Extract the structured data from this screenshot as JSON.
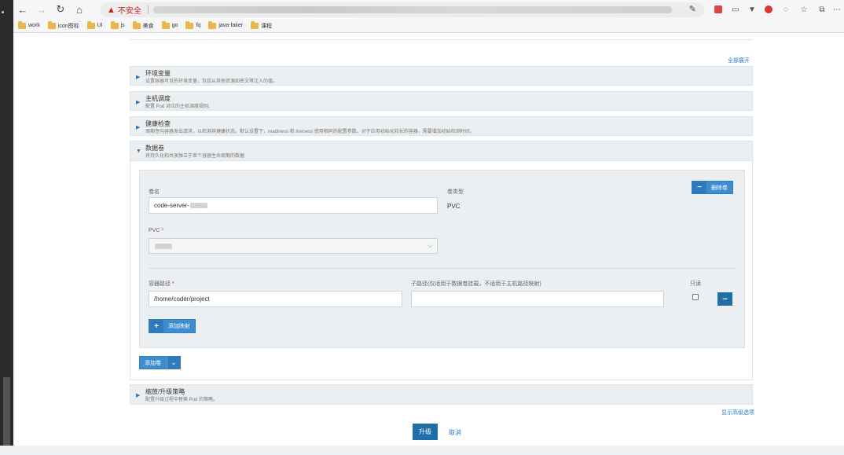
{
  "browser": {
    "insecure_label": "不安全",
    "bookmarks": [
      "work",
      "icon图标",
      "UI",
      "js",
      "美食",
      "go",
      "fq",
      "java-faker",
      "课程"
    ]
  },
  "page": {
    "expand_all": "全部展开",
    "sections": {
      "env": {
        "title": "环境变量",
        "desc": "设置容器可见的环境变量，包括从其他资源如密文等注入的值。"
      },
      "node": {
        "title": "主机调度",
        "desc": "配置 Pod 对应的主机调度规则。"
      },
      "health": {
        "title": "健康检查",
        "desc": "周期性向容器发出请求，以检测其健康状态。默认设置下，readiness 和 liveness 使用相同的配置参数。对于应用初始化较长的容器，需要增加初始检测时间。"
      },
      "volumes": {
        "title": "数据卷",
        "desc": "将持久化和共享独立于单个容器生命周期的数据"
      },
      "scaling": {
        "title": "缩放/升级策略",
        "desc": "配置升级过程中替换 Pod 的策略。"
      }
    },
    "volume": {
      "name_label": "卷名",
      "name_value": "code-server-",
      "type_label": "卷类型",
      "type_value": "PVC",
      "remove_label": "删除卷",
      "pvc_label": "PVC",
      "mount_label": "容器路径",
      "mount_value": "/home/coder/project",
      "subpath_label": "子路径(仅适用于数据卷挂载，不适用于主机路径映射)",
      "subpath_value": "",
      "readonly_label": "只读",
      "add_mount_label": "添加映射"
    },
    "add_volume_label": "添加卷",
    "advanced_label": "显示高级选项",
    "upgrade_label": "升级",
    "cancel_label": "取消"
  },
  "colors": {
    "primary": "#3d8ed0",
    "primary_dark": "#1f6ea8",
    "link": "#2e7bc4",
    "section_bg": "#eceff1",
    "required": "#d9302b"
  },
  "icons": [
    "back-icon",
    "forward-icon",
    "reload-icon",
    "home-icon",
    "warning-icon",
    "folder-icon",
    "chevron-down-icon",
    "minus-icon",
    "plus-icon",
    "triangle-right-icon",
    "triangle-down-icon"
  ]
}
